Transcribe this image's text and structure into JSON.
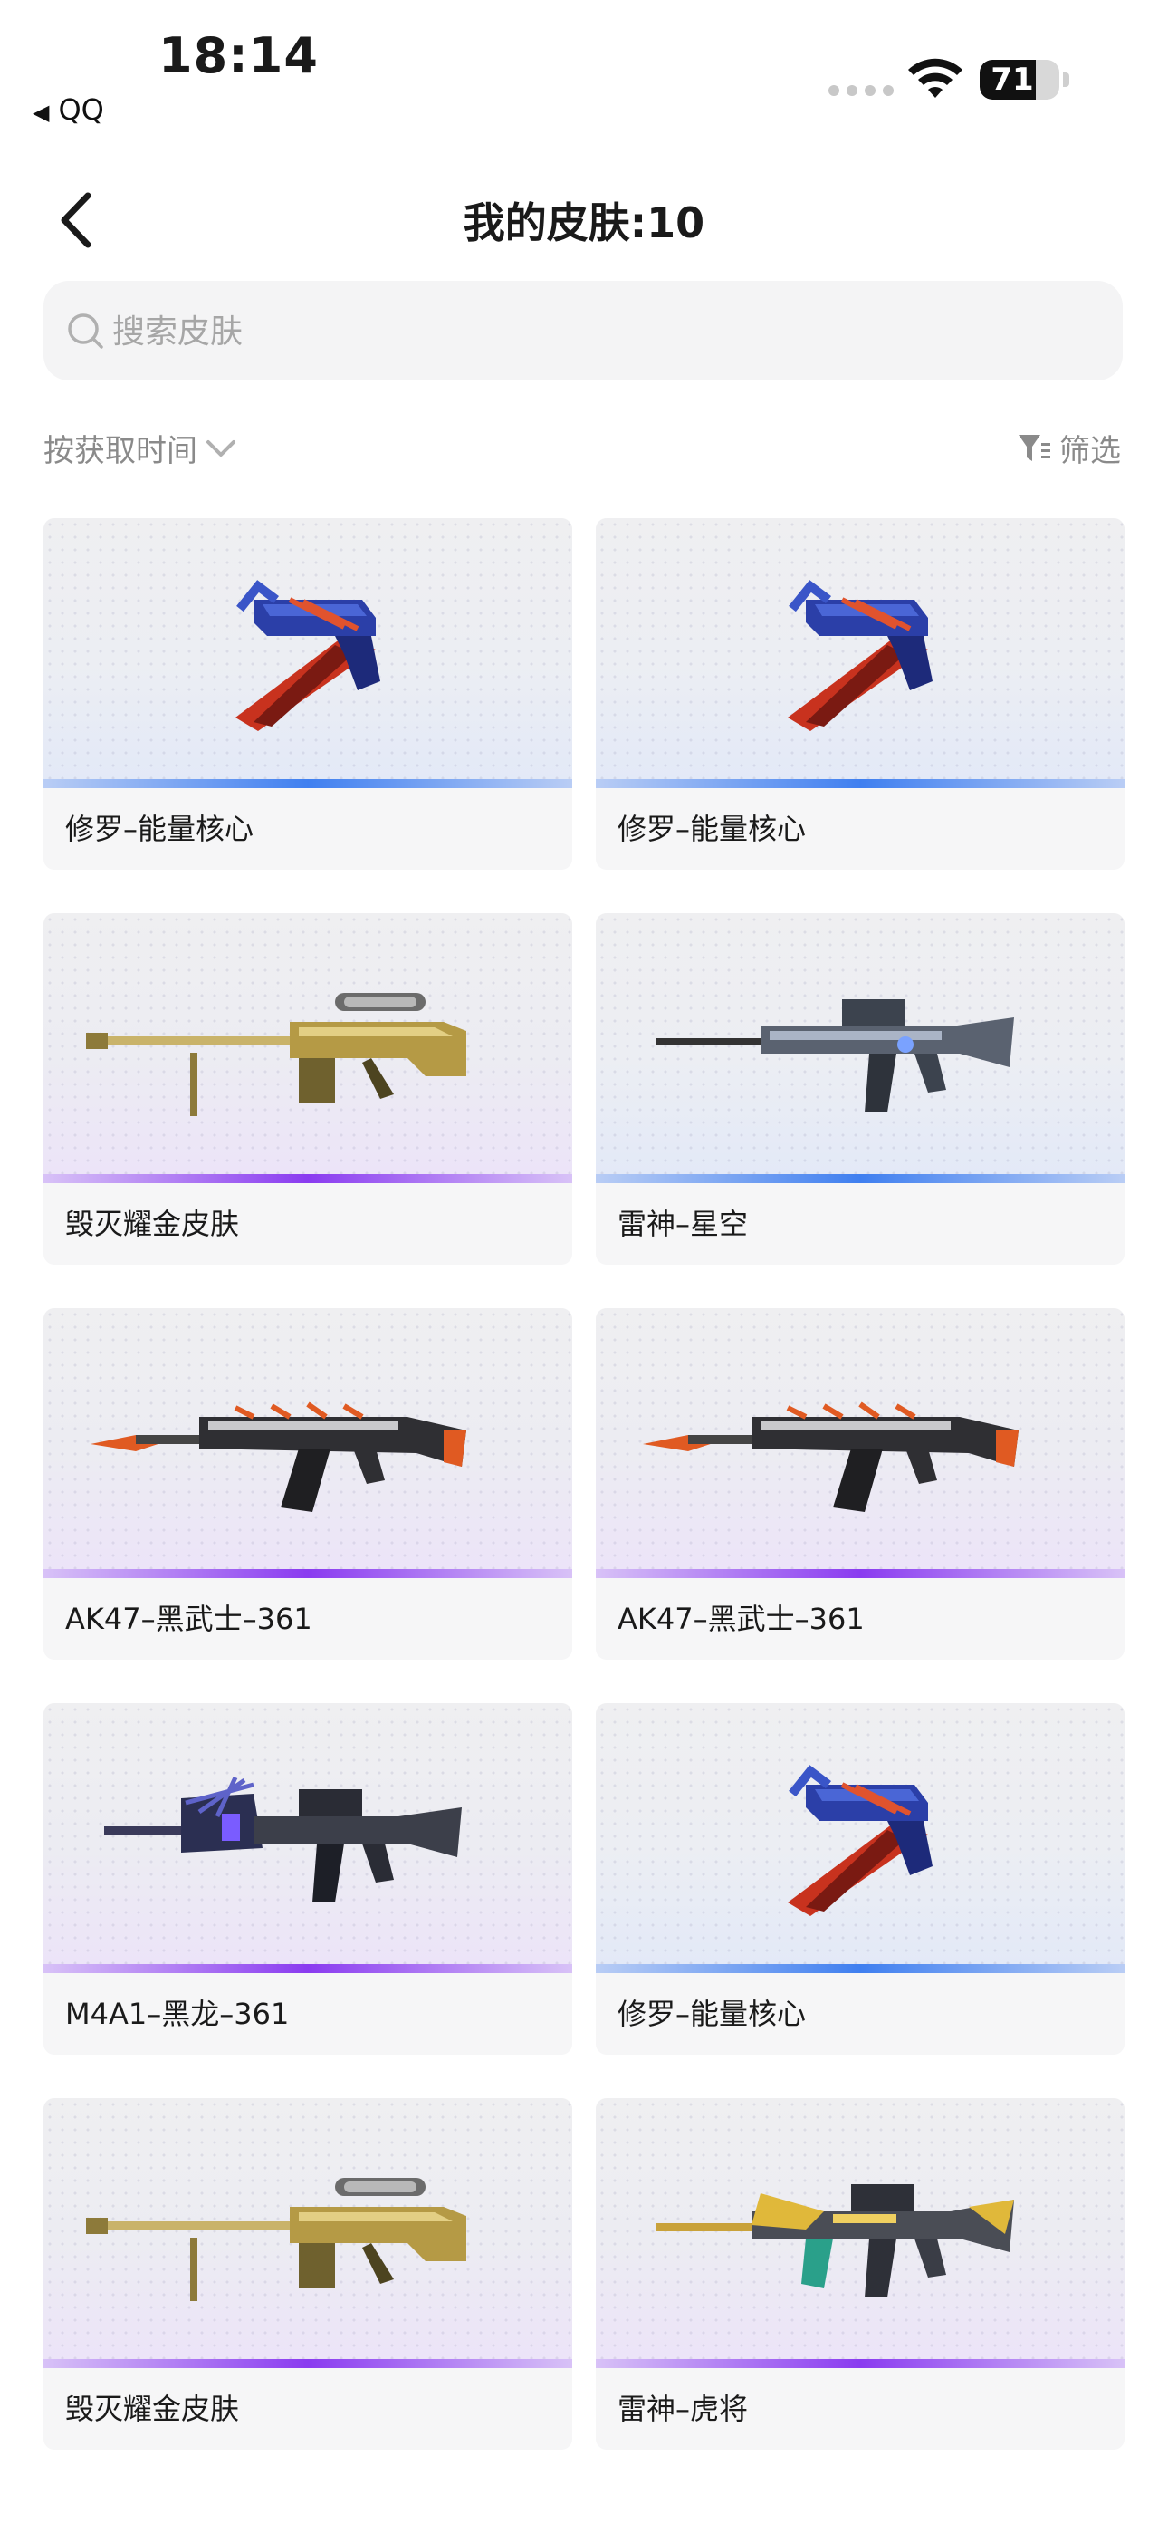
{
  "status_bar": {
    "time": "18:14",
    "back_app": "QQ",
    "battery": "71",
    "battery_level": 0.71
  },
  "nav": {
    "title": "我的皮肤:10"
  },
  "search": {
    "placeholder": "搜索皮肤"
  },
  "sort": {
    "label": "按获取时间"
  },
  "filter": {
    "label": "筛选"
  },
  "skins": [
    {
      "name": "修罗–能量核心",
      "rarity": "blue",
      "weapon": "pistol"
    },
    {
      "name": "修罗–能量核心",
      "rarity": "blue",
      "weapon": "pistol"
    },
    {
      "name": "毁灭耀金皮肤",
      "rarity": "purple",
      "weapon": "sniper"
    },
    {
      "name": "雷神–星空",
      "rarity": "blue",
      "weapon": "rifle-m4"
    },
    {
      "name": "AK47–黑武士–361",
      "rarity": "purple",
      "weapon": "rifle-ak"
    },
    {
      "name": "AK47–黑武士–361",
      "rarity": "purple",
      "weapon": "rifle-ak"
    },
    {
      "name": "M4A1–黑龙–361",
      "rarity": "purple",
      "weapon": "rifle-m4-dragon"
    },
    {
      "name": "修罗–能量核心",
      "rarity": "blue",
      "weapon": "pistol"
    },
    {
      "name": "毁灭耀金皮肤",
      "rarity": "purple",
      "weapon": "sniper"
    },
    {
      "name": "雷神–虎将",
      "rarity": "purple",
      "weapon": "rifle-m4-gold"
    }
  ],
  "colors": {
    "blue_rarity": "#3f7ff0",
    "purple_rarity": "#8a3bf0"
  }
}
